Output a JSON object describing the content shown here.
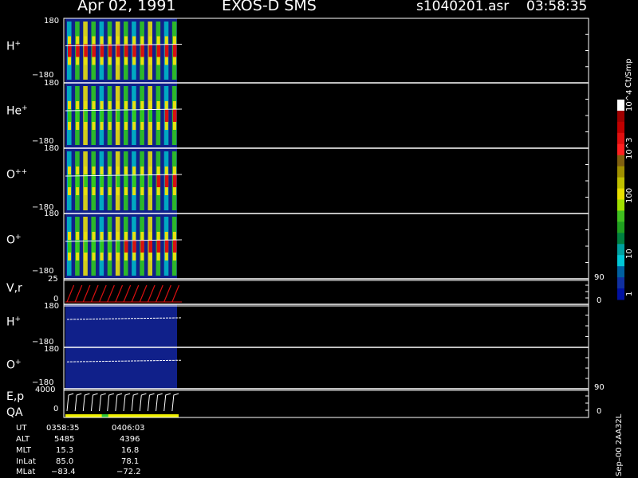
{
  "header": {
    "date": "Apr 02, 1991",
    "instrument": "EXOS-D SMS",
    "file": "s1040201.asr",
    "time": "03:58:35"
  },
  "colors": {
    "background": "#000000",
    "fill": "#10208a",
    "red": "#d81010",
    "yellow": "#e8e010",
    "green": "#30c820",
    "cyan": "#00b8c8",
    "frame": "#ffffff",
    "qa_bar": "#f0f000",
    "qa_mark": "#30c830"
  },
  "colorbar": {
    "unit": "Ct/Smp",
    "ticks": [
      "1",
      "10",
      "100",
      "10^3",
      "10^4"
    ]
  },
  "chart_data": {
    "type": "heatmap",
    "panels": [
      {
        "label_base": "H",
        "label_sup": "+",
        "ytop": "180",
        "ybot": "−180"
      },
      {
        "label_base": "He",
        "label_sup": "+",
        "ytop": "180",
        "ybot": "−180"
      },
      {
        "label_base": "O",
        "label_sup": "++",
        "ytop": "180",
        "ybot": "−180"
      },
      {
        "label_base": "O",
        "label_sup": "+",
        "ytop": "180",
        "ybot": "−180"
      },
      {
        "label_base": "V,r",
        "label_sup": "",
        "ytop": "25",
        "ybot": "0",
        "rtop": "90",
        "rbot": "0"
      },
      {
        "label_base": "H",
        "label_sup": "+",
        "ytop": "180",
        "ybot": "−180"
      },
      {
        "label_base": "O",
        "label_sup": "+",
        "ytop": "180",
        "ybot": "−180"
      },
      {
        "label_base": "E,p",
        "label_sup": "",
        "label2": "QA",
        "ytop": "4000",
        "ybot": "0",
        "rtop": "90",
        "rbot": "0"
      }
    ],
    "spin_count": 14
  },
  "footer": {
    "rows": [
      {
        "label": "UT",
        "v1": "0358:35",
        "v2": "0406:03"
      },
      {
        "label": "ALT",
        "v1": "5485",
        "v2": "4396"
      },
      {
        "label": "MLT",
        "v1": "15.3",
        "v2": "16.8"
      },
      {
        "label": "InLat",
        "v1": "85.0",
        "v2": "78.1"
      },
      {
        "label": "MLat",
        "v1": "−83.4",
        "v2": "−72.2"
      }
    ],
    "version": "Sep–00 2AA32L"
  }
}
